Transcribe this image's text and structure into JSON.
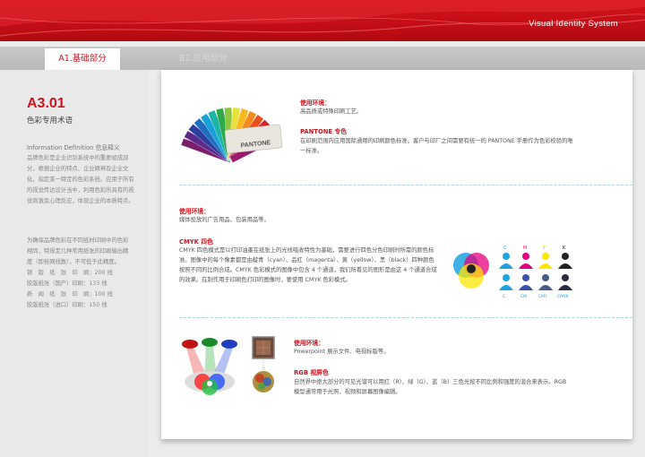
{
  "banner": {
    "title": "Visual Identity System"
  },
  "tabs": [
    {
      "label": "A1.基础部分",
      "active": true
    },
    {
      "label": "B2.应用部分",
      "active": false
    }
  ],
  "left": {
    "code": "A3.01",
    "title": "色彩专用术语",
    "info_heading": "Information Definition 信息释义",
    "info_text": "品牌色彩是企业识别系统中的重要组成部分，根据企业的特点、企业精神及企业文化，指定某一特定的色彩系统。应用于所有的视觉传达设计当中，利用色彩所具有的视觉刺激及心理反应，体现企业的本质特点。",
    "info_lines": [
      "为确保品牌色彩在不同纸材印刷中的色彩",
      "相同，特规定几种常用纸张的印刷输出精",
      "度（即挂网线数），不可低于此精度。",
      "铜　版　纸　张　印　刷：200 线",
      "胶版纸张（国产）印刷：133 线",
      "新　闻　纸　张　印　刷：100 线",
      "胶版纸张（进口）印刷：150 线"
    ]
  },
  "sections": [
    {
      "env_label": "使用环境：",
      "env_text": "高品质或特殊印刷工艺。",
      "term_label": "PANTONE 专色",
      "term_text": "在印刷范围内应用国际通用的印刷颜色标准。客户与印厂之间需要有统一的 PANTONE 手册作为色彩校验的唯一标准。"
    },
    {
      "env_label": "使用环境：",
      "env_text": "媒体投放的广告用品、包装用品等。",
      "term_label": "CMYK 四色",
      "term_text": "CMYK 四色模式是以打印油墨在纸张上的光线吸收特性为基础，需要进行四色分色印刷时所需的颜色标准。图像中的每个像素都是由靛青（cyan）、品红（magenta）、黄（yellow）、黑（black）四种颜色按照不同的比例合成。CMYK 色彩模式的图像中包含 4 个通道，我们所看见的图形是由这 4 个通道合成的效果。在制作用于印刷色打印的图像时，要使用 CMYK 色彩模式。"
    },
    {
      "env_label": "使用环境：",
      "env_text": "Powerpoint 展示文件、电视标版等。",
      "term_label": "RGB 视屏色",
      "term_text": "自然界中绝大部分的可见光谱可以用红（R）、绿（G）、蓝（B）三色光按不同比例和强度的混合来表示。RGB 模型通常用于光照、视频和屏幕图像编辑。"
    }
  ],
  "illustrations": {
    "pantone_fan_text": "PANTONE",
    "cmyk_labels": [
      "C",
      "M",
      "Y",
      "K"
    ],
    "cmyk_bottom_labels": [
      "C",
      "CM",
      "CMY",
      "CMYK"
    ]
  }
}
